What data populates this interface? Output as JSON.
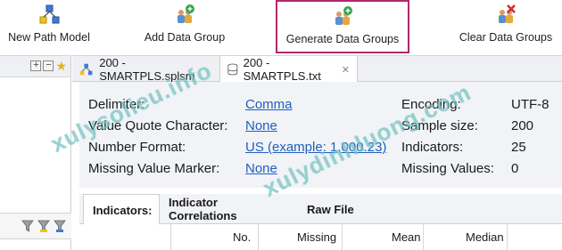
{
  "toolbar": {
    "new_path_model": "New Path Model",
    "add_data_group": "Add Data Group",
    "generate_data_groups": "Generate Data Groups",
    "clear_data_groups": "Clear Data Groups"
  },
  "tabs": [
    {
      "label": "200 - SMARTPLS.splsm",
      "active": false
    },
    {
      "label": "200 - SMARTPLS.txt",
      "active": true
    }
  ],
  "settings": {
    "delimiter_label": "Delimiter:",
    "delimiter_value": "Comma",
    "quote_label": "Value Quote Character:",
    "quote_value": "None",
    "number_format_label": "Number Format:",
    "number_format_value": "US (example: 1,000.23)",
    "missing_marker_label": "Missing Value Marker:",
    "missing_marker_value": "None"
  },
  "stats": {
    "encoding_label": "Encoding:",
    "encoding_value": "UTF-8",
    "sample_size_label": "Sample size:",
    "sample_size_value": "200",
    "indicators_label": "Indicators:",
    "indicators_value": "25",
    "missing_values_label": "Missing Values:",
    "missing_values_value": "0"
  },
  "subtabs": [
    "Indicators:",
    "Indicator Correlations",
    "Raw File"
  ],
  "table": {
    "columns": [
      "No.",
      "Missing",
      "Mean",
      "Median"
    ]
  },
  "watermarks": [
    "xulysolieu.info",
    "xulydinhluong.com"
  ],
  "colors": {
    "link": "#1f5fbf",
    "highlight_border": "#b0286c",
    "panel_bg": "#f1f3f7"
  }
}
